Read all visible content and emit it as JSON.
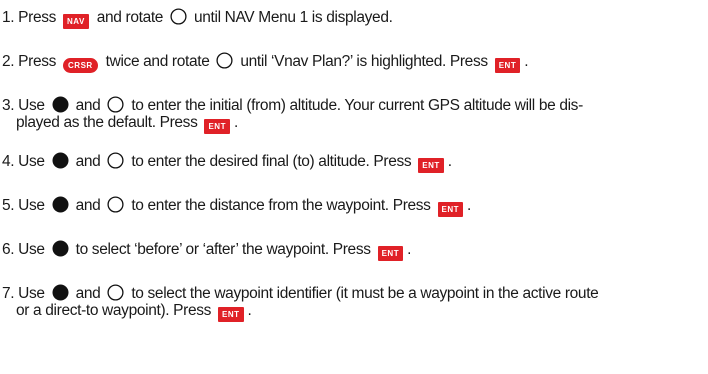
{
  "steps": [
    {
      "id": "step-1",
      "parts": [
        {
          "t": "text",
          "v": "1. Press "
        },
        {
          "t": "key",
          "v": "NAV",
          "name": "nav-key-icon"
        },
        {
          "t": "text",
          "v": " and rotate "
        },
        {
          "t": "knob",
          "style": "outer",
          "name": "outer-knob-icon"
        },
        {
          "t": "text",
          "v": " until NAV Menu 1 is displayed."
        }
      ]
    },
    {
      "id": "step-2",
      "parts": [
        {
          "t": "text",
          "v": "2. Press "
        },
        {
          "t": "key",
          "v": "CRSR",
          "name": "crsr-key-icon",
          "shape": "round"
        },
        {
          "t": "text",
          "v": " twice and rotate "
        },
        {
          "t": "knob",
          "style": "outer",
          "name": "outer-knob-icon"
        },
        {
          "t": "text",
          "v": " until ‘Vnav Plan?’ is highlighted. Press "
        },
        {
          "t": "key",
          "v": "ENT",
          "name": "ent-key-icon"
        },
        {
          "t": "text",
          "v": "."
        }
      ]
    },
    {
      "id": "step-3",
      "parts": [
        {
          "t": "text",
          "v": "3. Use "
        },
        {
          "t": "knob",
          "style": "inner",
          "name": "inner-knob-icon"
        },
        {
          "t": "text",
          "v": " and "
        },
        {
          "t": "knob",
          "style": "outer",
          "name": "outer-knob-icon"
        },
        {
          "t": "text",
          "v": " to enter the initial (from) altitude. Your current GPS altitude will be dis-"
        },
        {
          "t": "br"
        },
        {
          "t": "text",
          "v": "played as the default. Press "
        },
        {
          "t": "key",
          "v": "ENT",
          "name": "ent-key-icon"
        },
        {
          "t": "text",
          "v": "."
        }
      ]
    },
    {
      "id": "step-4",
      "parts": [
        {
          "t": "text",
          "v": "4. Use "
        },
        {
          "t": "knob",
          "style": "inner",
          "name": "inner-knob-icon"
        },
        {
          "t": "text",
          "v": " and "
        },
        {
          "t": "knob",
          "style": "outer",
          "name": "outer-knob-icon"
        },
        {
          "t": "text",
          "v": " to enter the desired final (to) altitude. Press "
        },
        {
          "t": "key",
          "v": "ENT",
          "name": "ent-key-icon"
        },
        {
          "t": "text",
          "v": "."
        }
      ]
    },
    {
      "id": "step-5",
      "parts": [
        {
          "t": "text",
          "v": "5. Use "
        },
        {
          "t": "knob",
          "style": "inner",
          "name": "inner-knob-icon"
        },
        {
          "t": "text",
          "v": " and "
        },
        {
          "t": "knob",
          "style": "outer",
          "name": "outer-knob-icon"
        },
        {
          "t": "text",
          "v": " to enter the distance from the waypoint. Press "
        },
        {
          "t": "key",
          "v": "ENT",
          "name": "ent-key-icon"
        },
        {
          "t": "text",
          "v": "."
        }
      ]
    },
    {
      "id": "step-6",
      "parts": [
        {
          "t": "text",
          "v": "6. Use "
        },
        {
          "t": "knob",
          "style": "inner",
          "name": "inner-knob-icon"
        },
        {
          "t": "text",
          "v": " to select ‘before’ or ‘after’ the waypoint. Press "
        },
        {
          "t": "key",
          "v": "ENT",
          "name": "ent-key-icon"
        },
        {
          "t": "text",
          "v": "."
        }
      ]
    },
    {
      "id": "step-7",
      "parts": [
        {
          "t": "text",
          "v": "7. Use "
        },
        {
          "t": "knob",
          "style": "inner",
          "name": "inner-knob-icon"
        },
        {
          "t": "text",
          "v": " and "
        },
        {
          "t": "knob",
          "style": "outer",
          "name": "outer-knob-icon"
        },
        {
          "t": "text",
          "v": " to select the waypoint identifier (it must be a waypoint in the active route"
        },
        {
          "t": "br"
        },
        {
          "t": "text",
          "v": "or a direct-to waypoint). Press "
        },
        {
          "t": "key",
          "v": "ENT",
          "name": "ent-key-icon"
        },
        {
          "t": "text",
          "v": "."
        }
      ]
    }
  ],
  "colors": {
    "key_background": "#e02127",
    "key_text": "#ffffff",
    "text": "#1a1a1a"
  }
}
